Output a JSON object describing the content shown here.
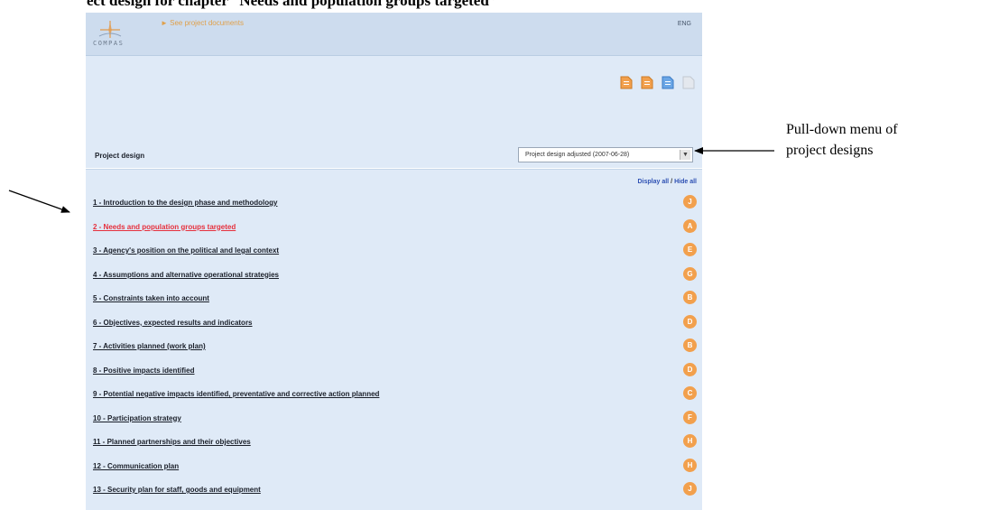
{
  "document": {
    "heading": "ect design for chapter “Needs and population groups targeted”"
  },
  "app": {
    "logo_text": "COMPAS",
    "header_link": "► See project documents",
    "header_right": "ENG",
    "toolbar_icons": [
      "orange-document-icon",
      "orange-document-icon",
      "blue-document-icon",
      "grey-document-icon"
    ],
    "section_label": "Project design",
    "design_select": {
      "value": "Project design adjusted (2007-06-28)"
    },
    "display_all": "Display all",
    "hide_all": "Hide all",
    "chapters": [
      {
        "title": "1 - Introduction to the design phase and methodology",
        "badge": "J"
      },
      {
        "title": "2 - Needs and population groups targeted",
        "badge": "A"
      },
      {
        "title": "3 - Agency's position on the political and legal context",
        "badge": "E"
      },
      {
        "title": "4 - Assumptions and alternative operational strategies",
        "badge": "G"
      },
      {
        "title": "5 - Constraints taken into account",
        "badge": "B"
      },
      {
        "title": "6 - Objectives, expected results and indicators",
        "badge": "D"
      },
      {
        "title": "7 - Activities planned (work plan)",
        "badge": "B"
      },
      {
        "title": "8 - Positive impacts identified",
        "badge": "D"
      },
      {
        "title": "9 - Potential negative impacts identified, preventative and corrective action planned",
        "badge": "C"
      },
      {
        "title": "10 - Participation strategy",
        "badge": "F"
      },
      {
        "title": "11 - Planned partnerships and their objectives",
        "badge": "H"
      },
      {
        "title": "12 - Communication plan",
        "badge": "H"
      },
      {
        "title": "13 - Security plan for staff, goods and equipment",
        "badge": "J"
      }
    ],
    "active_chapter": 2,
    "colors": {
      "badge": "#f2a04d",
      "active": "#e6303d",
      "panel": "#dfeaf7"
    }
  },
  "annotation": {
    "callout_lines": [
      "Pull-down menu of",
      "project designs"
    ]
  }
}
